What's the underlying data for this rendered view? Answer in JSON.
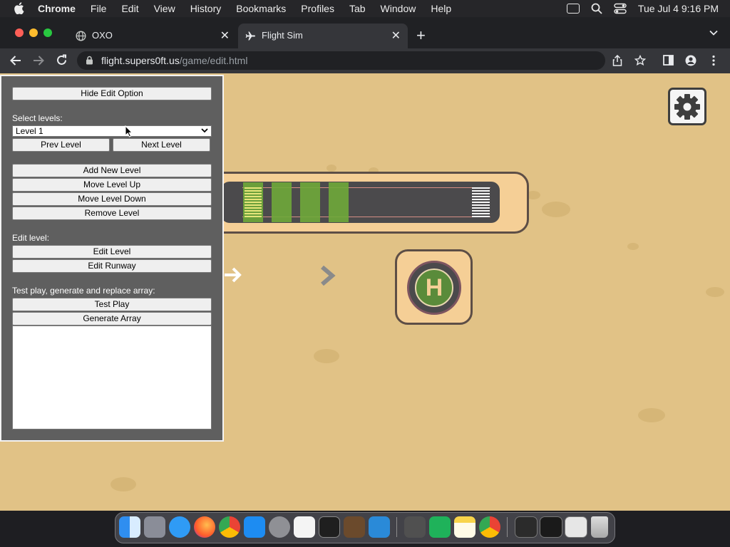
{
  "menubar": {
    "app": "Chrome",
    "items": [
      "File",
      "Edit",
      "View",
      "History",
      "Bookmarks",
      "Profiles",
      "Tab",
      "Window",
      "Help"
    ],
    "clock": "Tue Jul 4  9:16 PM"
  },
  "tabs": [
    {
      "title": "OXO",
      "icon": "globe-icon"
    },
    {
      "title": "Flight Sim",
      "icon": "airplane-icon",
      "active": true
    }
  ],
  "url": {
    "host": "flight.supers0ft.us",
    "path": "/game/edit.html"
  },
  "panel": {
    "hide_button": "Hide Edit Option",
    "select_levels_label": "Select levels:",
    "level_select_value": "Level 1",
    "prev_level": "Prev Level",
    "next_level": "Next Level",
    "add_new_level": "Add New Level",
    "move_level_up": "Move Level Up",
    "move_level_down": "Move Level Down",
    "remove_level": "Remove Level",
    "edit_level_label": "Edit level:",
    "edit_level_button": "Edit Level",
    "edit_runway_button": "Edit Runway",
    "test_label": "Test play, generate and replace array:",
    "test_play": "Test Play",
    "generate_array": "Generate Array",
    "array_text": ""
  },
  "game": {
    "helipad_letter": "H",
    "settings_icon": "gear-icon"
  },
  "colors": {
    "sand": "#e1c286",
    "pad": "#f5cf96",
    "outline": "#5d4e46",
    "asphalt": "#4b4a4c",
    "grass": "#6fa83a"
  },
  "dock": [
    "finder-icon",
    "launchpad-icon",
    "safari-icon",
    "firefox-icon",
    "chrome-icon",
    "app-store-icon",
    "system-settings-icon",
    "textedit-icon",
    "terminal-icon",
    "garageband-icon",
    "vscode-icon",
    "calculator-icon",
    "numbers-icon",
    "notes-icon",
    "chrome-icon",
    "trash-icon"
  ]
}
